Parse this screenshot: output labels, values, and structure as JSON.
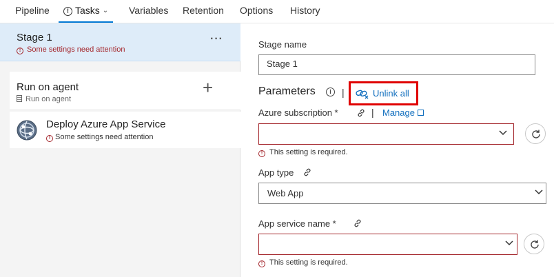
{
  "tabs": [
    {
      "label": "Pipeline"
    },
    {
      "label": "Tasks"
    },
    {
      "label": "Variables"
    },
    {
      "label": "Retention"
    },
    {
      "label": "Options"
    },
    {
      "label": "History"
    }
  ],
  "stage": {
    "title": "Stage 1",
    "warning": "Some settings need attention",
    "more": "···"
  },
  "job": {
    "title": "Run on agent",
    "subtitle": "Run on agent",
    "add": "+"
  },
  "task": {
    "title": "Deploy Azure App Service",
    "warning": "Some settings need attention",
    "icon": "azure-app-service-icon"
  },
  "form": {
    "stage_name_label": "Stage name",
    "stage_name_value": "Stage 1",
    "parameters_title": "Parameters",
    "separator": "|",
    "unlink_all": "Unlink all",
    "azure_subscription_label": "Azure subscription *",
    "manage_link": "Manage",
    "azure_subscription_value": "",
    "azure_subscription_error": "This setting is required.",
    "app_type_label": "App type",
    "app_type_value": "Web App",
    "app_service_name_label": "App service name *",
    "app_service_name_value": "",
    "app_service_name_error": "This setting is required."
  },
  "colors": {
    "accent": "#0078d4",
    "link": "#106ebe",
    "error": "#a4262c",
    "highlight_box": "#e00000",
    "stage_selected_bg": "#deecf9"
  }
}
